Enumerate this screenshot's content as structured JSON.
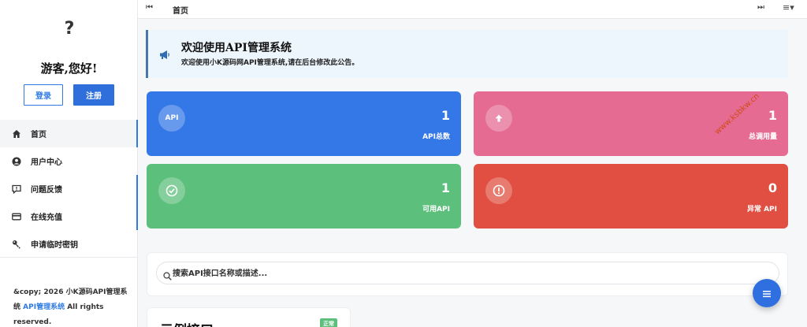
{
  "sidebar": {
    "avatar_glyph": "?",
    "greeting": "游客,您好!",
    "login_label": "登录",
    "register_label": "注册",
    "nav": [
      {
        "label": "首页",
        "icon": "home-icon"
      },
      {
        "label": "用户中心",
        "icon": "user-circle-icon"
      },
      {
        "label": "问题反馈",
        "icon": "feedback-icon"
      },
      {
        "label": "在线充值",
        "icon": "credit-card-icon"
      },
      {
        "label": "申请临时密钥",
        "icon": "key-icon"
      }
    ],
    "footer_text": "&copy; 2026 小K源码API管理系统",
    "footer_link": "API管理系统",
    "footer_tail": "All rights reserved."
  },
  "topbar": {
    "first_icon": "⏮",
    "tab_label": "首页",
    "last_icon": "⏭",
    "menu_icon": "≡▾"
  },
  "notice": {
    "title": "欢迎使用API管理系统",
    "text": "欢迎使用小K源码网API管理系统,请在后台修改此公告。"
  },
  "stats": [
    {
      "value": "1",
      "label": "API总数",
      "icon_text": "API",
      "color": "#3477e6"
    },
    {
      "value": "1",
      "label": "总调用量",
      "icon": "arrow-up-icon",
      "color": "#e56b93"
    },
    {
      "value": "1",
      "label": "可用API",
      "icon": "check-circle-icon",
      "color": "#5cbf7c"
    },
    {
      "value": "0",
      "label": "异常 API",
      "icon": "exclamation-circle-icon",
      "color": "#e04f41"
    }
  ],
  "search": {
    "placeholder": "搜索API接口名称或描述..."
  },
  "example": {
    "title": "示例接口",
    "badge": "正常"
  },
  "watermark": "www.ksbkw.cn"
}
